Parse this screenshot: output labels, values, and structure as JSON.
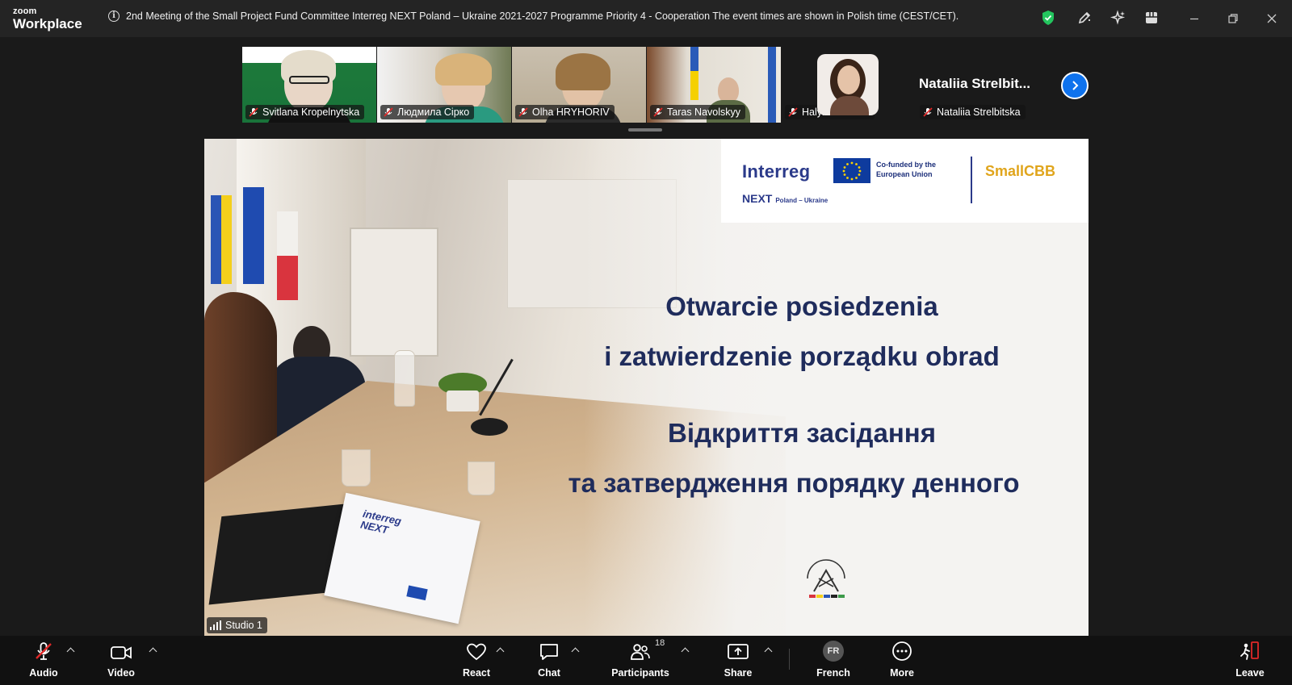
{
  "app": {
    "brand_small": "zoom",
    "brand_large": "Workplace"
  },
  "meeting": {
    "title": "2nd Meeting of the Small Project Fund Committee Interreg NEXT Poland – Ukraine 2021-2027 Programme Priority 4 - Cooperation  The event times are shown in Polish time (CEST/CET)."
  },
  "participants": [
    {
      "name": "Svitlana Kropelnytska"
    },
    {
      "name": "Людмила Сірко"
    },
    {
      "name": "Olha HRYHORIV"
    },
    {
      "name": "Taras Navolskyy"
    },
    {
      "name": "Halyna Loboda"
    },
    {
      "name": "Nataliia Strelbitska"
    }
  ],
  "speaker_big_name": "Nataliia  Strelbit...",
  "slide": {
    "logo_interreg": "Interreg",
    "logo_cofunded": "Co-funded by the European Union",
    "logo_next": "NEXT",
    "logo_next_sub": "Poland – Ukraine",
    "logo_smallcbb": "SmallCBB",
    "line1": "Otwarcie posiedzenia",
    "line2": "i zatwierdzenie porządku obrad",
    "line3": "Відкриття засідання",
    "line4": "та затвердження порядку денного",
    "source_label": "Studio 1"
  },
  "toolbar": {
    "audio": "Audio",
    "video": "Video",
    "react": "React",
    "chat": "Chat",
    "participants": "Participants",
    "participants_count": "18",
    "share": "Share",
    "language_code": "FR",
    "language": "French",
    "more": "More",
    "leave": "Leave"
  },
  "colors": {
    "accent": "#0e72ed",
    "leave": "#e02828",
    "shield": "#23c55e",
    "mute": "#e02828"
  }
}
